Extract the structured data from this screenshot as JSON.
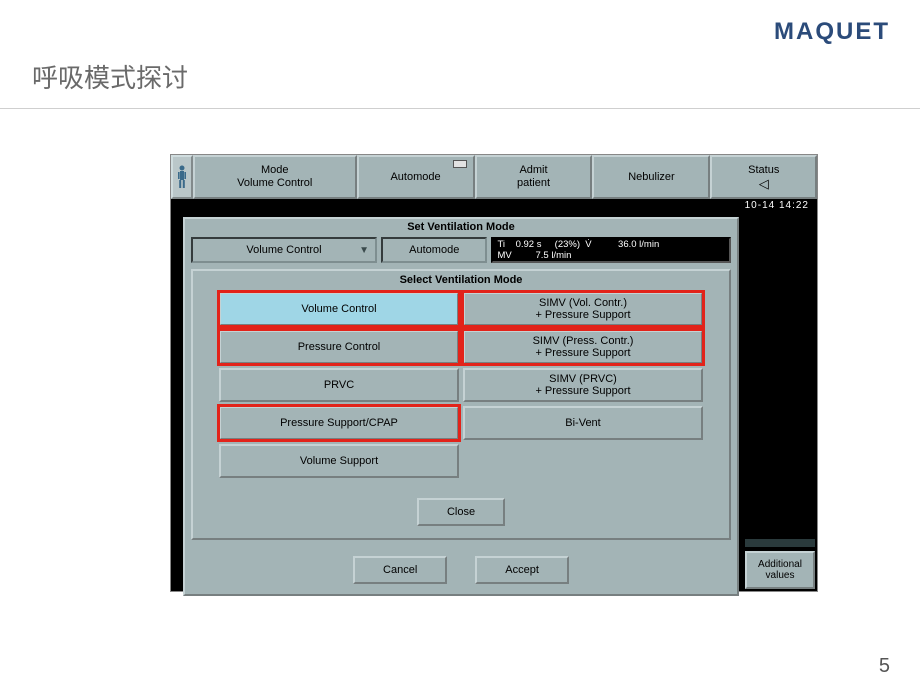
{
  "brand": "MAQUET",
  "slide_title": "呼吸模式探讨",
  "page_number": "5",
  "toolbar": {
    "mode_label": "Mode",
    "mode_value": "Volume Control",
    "automode": "Automode",
    "admit_l1": "Admit",
    "admit_l2": "patient",
    "nebulizer": "Nebulizer",
    "status": "Status"
  },
  "datetime": "10-14  14:22",
  "svm": {
    "title": "Set Ventilation Mode",
    "mode_combo": "Volume Control",
    "automode_combo": "Automode",
    "readout": {
      "ti_label": "Ti",
      "ti_value": "0.92 s",
      "ti_pct": "(23%)",
      "v_label": "V̇",
      "v_value": "36.0 l/min",
      "mv_label": "MV",
      "mv_value": "7.5 l/min"
    }
  },
  "select": {
    "title": "Select Ventilation Mode",
    "modes": {
      "vc": "Volume Control",
      "simv_vc_l1": "SIMV (Vol. Contr.)",
      "simv_vc_l2": "+ Pressure Support",
      "pc": "Pressure Control",
      "simv_pc_l1": "SIMV (Press. Contr.)",
      "simv_pc_l2": "+ Pressure Support",
      "prvc": "PRVC",
      "simv_prvc_l1": "SIMV (PRVC)",
      "simv_prvc_l2": "+ Pressure Support",
      "pscpap": "Pressure Support/CPAP",
      "bivent": "Bi-Vent",
      "vs": "Volume Support"
    },
    "close": "Close"
  },
  "svm_bottom": {
    "cancel": "Cancel",
    "accept": "Accept"
  },
  "additional": {
    "l1": "Additional",
    "l2": "values"
  }
}
